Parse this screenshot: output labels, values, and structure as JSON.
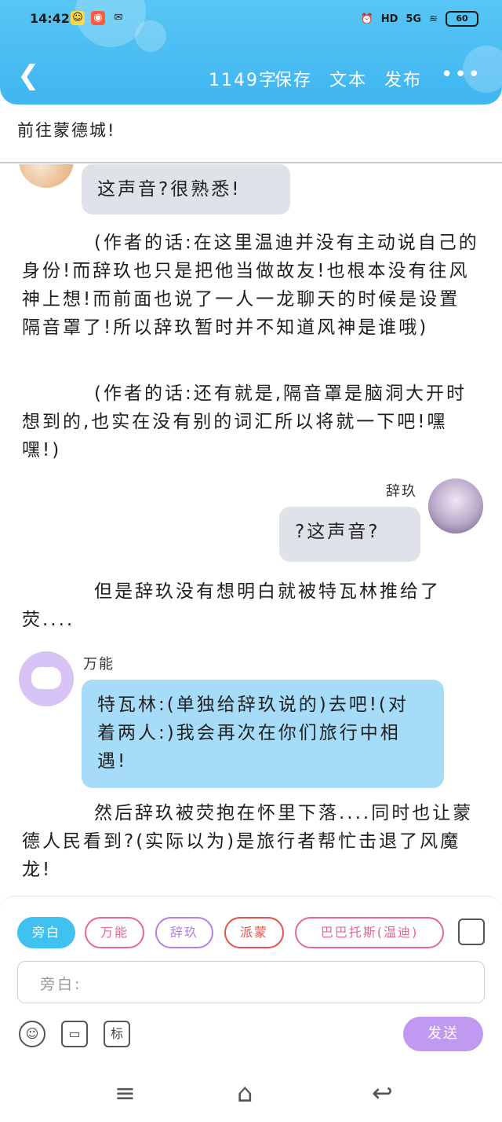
{
  "status_bar": {
    "time": "14:42",
    "network": "5G",
    "hd": "HD",
    "battery": "60"
  },
  "toolbar": {
    "word_count": "1149字",
    "save_label": "保存",
    "text_label": "文本",
    "publish_label": "发布",
    "more_label": "•••"
  },
  "chapter_title": "前往蒙德城!",
  "messages": {
    "m1_text": "这声音?很熟悉!",
    "narr1": "(作者的话:在这里温迪并没有主动说自己的身份!而辞玖也只是把他当做故友!也根本没有往风神上想!而前面也说了一人一龙聊天的时候是设置隔音罩了!所以辞玖暂时并不知道风神是谁哦)",
    "narr2": "(作者的话:还有就是,隔音罩是脑洞大开时想到的,也实在没有别的词汇所以将就一下吧!嘿嘿!)",
    "m2_name": "辞玖",
    "m2_text": "?这声音?",
    "narr3": "但是辞玖没有想明白就被特瓦林推给了荧....",
    "m3_name": "万能",
    "m3_text": "特瓦林:(单独给辞玖说的)去吧!(对着两人:)我会再次在你们旅行中相遇!",
    "narr4": "然后辞玖被荧抱在怀里下落....同时也让蒙德人民看到?(实际以为)是旅行者帮忙击退了风魔龙!"
  },
  "composer": {
    "chips": [
      "旁白",
      "万能",
      "辞玖",
      "派蒙",
      "巴巴托斯(温迪)"
    ],
    "input_placeholder": "旁白:",
    "tool_tag_label": "标",
    "send_label": "发送"
  },
  "colors": {
    "header": "#3fb5f0",
    "send": "#c09af0",
    "chip_active": "#3fc2ef",
    "chip_pink": "#e8678f",
    "chip_purple": "#b77de6",
    "chip_red": "#e2524a"
  }
}
